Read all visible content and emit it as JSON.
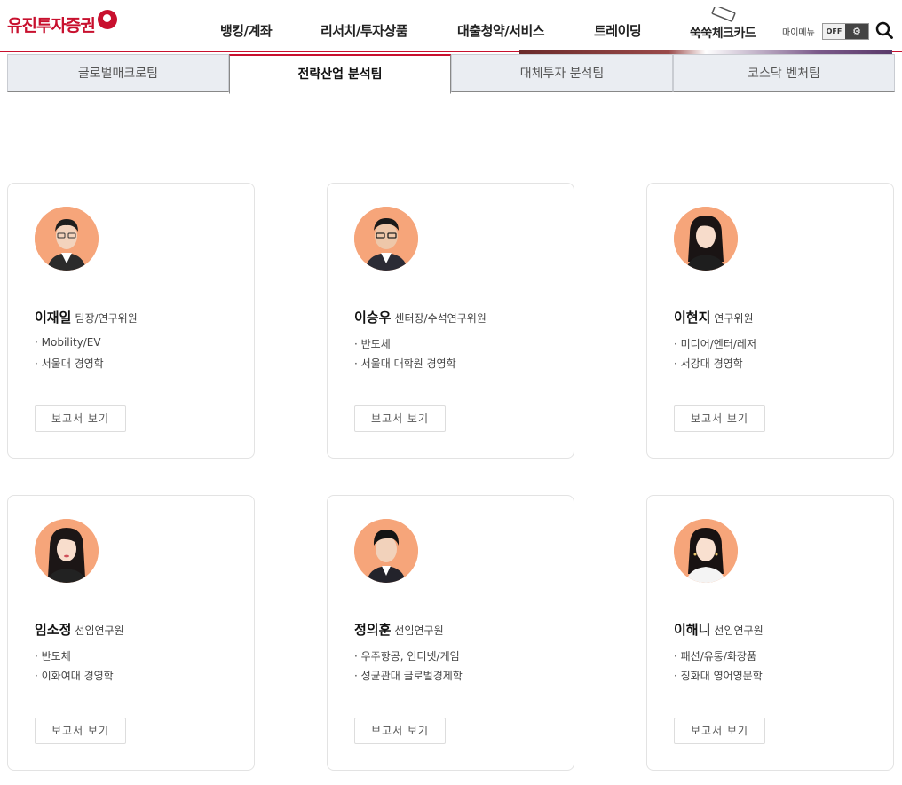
{
  "header": {
    "logo_text": "유진투자증권",
    "nav": [
      "뱅킹/계좌",
      "리서치/투자상품",
      "대출청약/서비스",
      "트레이딩",
      "쑥쑥체크카드"
    ],
    "mymenu_label": "마이메뉴",
    "toggle_label": "OFF",
    "brand_color": "#c8102e"
  },
  "tabs": [
    {
      "label": "글로벌매크로팀",
      "active": false
    },
    {
      "label": "전략산업 분석팀",
      "active": true
    },
    {
      "label": "대체투자 분석팀",
      "active": false
    },
    {
      "label": "코스닥 벤처팀",
      "active": false
    }
  ],
  "analysts": [
    {
      "name": "이재일",
      "title": "팀장/연구위원",
      "specs": [
        "· Mobility/EV",
        "· 서울대 경영학"
      ],
      "button": "보고서 보기",
      "avatar": "male-glasses"
    },
    {
      "name": "이승우",
      "title": "센터장/수석연구위원",
      "specs": [
        "· 반도체",
        "· 서울대 대학원 경영학"
      ],
      "button": "보고서 보기",
      "avatar": "male-glasses"
    },
    {
      "name": "이현지",
      "title": "연구위원",
      "specs": [
        "· 미디어/엔터/레저",
        "· 서강대 경영학"
      ],
      "button": "보고서 보기",
      "avatar": "female"
    },
    {
      "name": "임소정",
      "title": "선임연구원",
      "specs": [
        "· 반도체",
        "· 이화여대 경영학"
      ],
      "button": "보고서 보기",
      "avatar": "female"
    },
    {
      "name": "정의훈",
      "title": "선임연구원",
      "specs": [
        "· 우주항공, 인터넷/게임",
        "· 성균관대 글로벌경제학"
      ],
      "button": "보고서 보기",
      "avatar": "male"
    },
    {
      "name": "이해니",
      "title": "선임연구원",
      "specs": [
        "· 패션/유통/화장품",
        "· 칭화대 영어영문학"
      ],
      "button": "보고서 보기",
      "avatar": "female"
    }
  ]
}
